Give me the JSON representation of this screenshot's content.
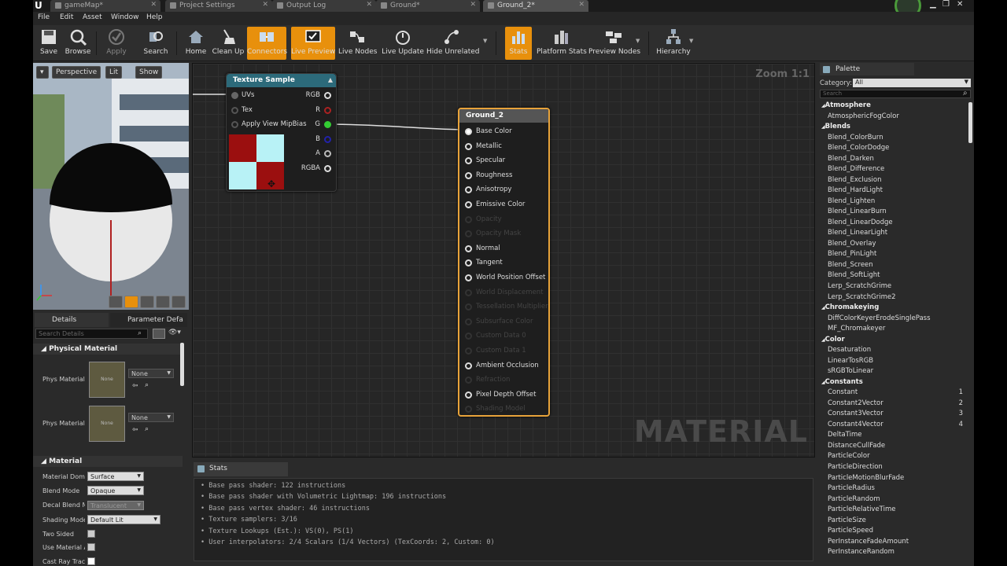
{
  "tabs": [
    {
      "label": "gameMap*",
      "active": false
    },
    {
      "label": "Project Settings",
      "active": false
    },
    {
      "label": "Output Log",
      "active": false
    },
    {
      "label": "Ground*",
      "active": false
    },
    {
      "label": "Ground_2*",
      "active": true
    }
  ],
  "menu": [
    "File",
    "Edit",
    "Asset",
    "Window",
    "Help"
  ],
  "toolbar": {
    "save": "Save",
    "browse": "Browse",
    "apply": "Apply",
    "search": "Search",
    "home": "Home",
    "clean_up": "Clean Up",
    "connectors": "Connectors",
    "live_preview": "Live Preview",
    "live_nodes": "Live Nodes",
    "live_update": "Live Update",
    "hide_unrelated": "Hide Unrelated",
    "stats": "Stats",
    "platform_stats": "Platform Stats",
    "preview_nodes": "Preview Nodes",
    "hierarchy": "Hierarchy"
  },
  "viewport": {
    "perspective": "Perspective",
    "lit": "Lit",
    "show": "Show"
  },
  "details": {
    "tab_details": "Details",
    "tab_params": "Parameter Defa",
    "search_placeholder": "Search Details",
    "cat_physical": "Physical Material",
    "phys_label_1": "Phys Material",
    "phys_label_2": "Phys Material",
    "phys_thumb_1": "None",
    "phys_thumb_2": "None",
    "phys_value_1": "None",
    "phys_value_2": "None",
    "cat_material": "Material",
    "rows": [
      {
        "label": "Material Doma",
        "value": "Surface"
      },
      {
        "label": "Blend Mode",
        "value": "Opaque"
      },
      {
        "label": "Decal Blend Mc",
        "value": "Translucent"
      },
      {
        "label": "Shading Mode",
        "value": "Default Lit"
      },
      {
        "label": "Two Sided",
        "value": ""
      },
      {
        "label": "Use Material A",
        "value": ""
      },
      {
        "label": "Cast Ray Trace",
        "value": ""
      }
    ]
  },
  "graph": {
    "zoom": "Zoom 1:1",
    "watermark": "MATERIAL",
    "texture_node": {
      "title": "Texture Sample",
      "inputs": [
        "UVs",
        "Tex",
        "Apply View MipBias"
      ],
      "outputs": [
        "RGB",
        "R",
        "G",
        "B",
        "A",
        "RGBA"
      ]
    },
    "material_node": {
      "title": "Ground_2",
      "pins": [
        {
          "label": "Base Color",
          "enabled": true
        },
        {
          "label": "Metallic",
          "enabled": true
        },
        {
          "label": "Specular",
          "enabled": true
        },
        {
          "label": "Roughness",
          "enabled": true
        },
        {
          "label": "Anisotropy",
          "enabled": true
        },
        {
          "label": "Emissive Color",
          "enabled": true
        },
        {
          "label": "Opacity",
          "enabled": false
        },
        {
          "label": "Opacity Mask",
          "enabled": false
        },
        {
          "label": "Normal",
          "enabled": true
        },
        {
          "label": "Tangent",
          "enabled": true
        },
        {
          "label": "World Position Offset",
          "enabled": true
        },
        {
          "label": "World Displacement",
          "enabled": false
        },
        {
          "label": "Tessellation Multiplier",
          "enabled": false
        },
        {
          "label": "Subsurface Color",
          "enabled": false
        },
        {
          "label": "Custom Data 0",
          "enabled": false
        },
        {
          "label": "Custom Data 1",
          "enabled": false
        },
        {
          "label": "Ambient Occlusion",
          "enabled": true
        },
        {
          "label": "Refraction",
          "enabled": false
        },
        {
          "label": "Pixel Depth Offset",
          "enabled": true
        },
        {
          "label": "Shading Model",
          "enabled": false
        }
      ]
    }
  },
  "stats": {
    "tab": "Stats",
    "lines": [
      "• Base pass shader: 122 instructions",
      "• Base pass shader with Volumetric Lightmap: 196 instructions",
      "• Base pass vertex shader: 46 instructions",
      "• Texture samplers: 3/16",
      "• Texture Lookups (Est.): VS(0), PS(1)",
      "• User interpolators: 2/4 Scalars (1/4 Vectors) (TexCoords: 2, Custom: 0)"
    ]
  },
  "palette": {
    "tab": "Palette",
    "category_label": "Category:",
    "category_value": "All",
    "search_placeholder": "Search",
    "items": [
      {
        "label": "Atmosphere",
        "head": true,
        "num": ""
      },
      {
        "label": "AtmosphericFogColor",
        "head": false,
        "num": ""
      },
      {
        "label": "Blends",
        "head": true,
        "num": ""
      },
      {
        "label": "Blend_ColorBurn",
        "head": false,
        "num": ""
      },
      {
        "label": "Blend_ColorDodge",
        "head": false,
        "num": ""
      },
      {
        "label": "Blend_Darken",
        "head": false,
        "num": ""
      },
      {
        "label": "Blend_Difference",
        "head": false,
        "num": ""
      },
      {
        "label": "Blend_Exclusion",
        "head": false,
        "num": ""
      },
      {
        "label": "Blend_HardLight",
        "head": false,
        "num": ""
      },
      {
        "label": "Blend_Lighten",
        "head": false,
        "num": ""
      },
      {
        "label": "Blend_LinearBurn",
        "head": false,
        "num": ""
      },
      {
        "label": "Blend_LinearDodge",
        "head": false,
        "num": ""
      },
      {
        "label": "Blend_LinearLight",
        "head": false,
        "num": ""
      },
      {
        "label": "Blend_Overlay",
        "head": false,
        "num": ""
      },
      {
        "label": "Blend_PinLight",
        "head": false,
        "num": ""
      },
      {
        "label": "Blend_Screen",
        "head": false,
        "num": ""
      },
      {
        "label": "Blend_SoftLight",
        "head": false,
        "num": ""
      },
      {
        "label": "Lerp_ScratchGrime",
        "head": false,
        "num": ""
      },
      {
        "label": "Lerp_ScratchGrime2",
        "head": false,
        "num": ""
      },
      {
        "label": "Chromakeying",
        "head": true,
        "num": ""
      },
      {
        "label": "DiffColorKeyerErodeSinglePass",
        "head": false,
        "num": ""
      },
      {
        "label": "MF_Chromakeyer",
        "head": false,
        "num": ""
      },
      {
        "label": "Color",
        "head": true,
        "num": ""
      },
      {
        "label": "Desaturation",
        "head": false,
        "num": ""
      },
      {
        "label": "LinearTosRGB",
        "head": false,
        "num": ""
      },
      {
        "label": "sRGBToLinear",
        "head": false,
        "num": ""
      },
      {
        "label": "Constants",
        "head": true,
        "num": ""
      },
      {
        "label": "Constant",
        "head": false,
        "num": "1"
      },
      {
        "label": "Constant2Vector",
        "head": false,
        "num": "2"
      },
      {
        "label": "Constant3Vector",
        "head": false,
        "num": "3"
      },
      {
        "label": "Constant4Vector",
        "head": false,
        "num": "4"
      },
      {
        "label": "DeltaTime",
        "head": false,
        "num": ""
      },
      {
        "label": "DistanceCullFade",
        "head": false,
        "num": ""
      },
      {
        "label": "ParticleColor",
        "head": false,
        "num": ""
      },
      {
        "label": "ParticleDirection",
        "head": false,
        "num": ""
      },
      {
        "label": "ParticleMotionBlurFade",
        "head": false,
        "num": ""
      },
      {
        "label": "ParticleRadius",
        "head": false,
        "num": ""
      },
      {
        "label": "ParticleRandom",
        "head": false,
        "num": ""
      },
      {
        "label": "ParticleRelativeTime",
        "head": false,
        "num": ""
      },
      {
        "label": "ParticleSize",
        "head": false,
        "num": ""
      },
      {
        "label": "ParticleSpeed",
        "head": false,
        "num": ""
      },
      {
        "label": "PerInstanceFadeAmount",
        "head": false,
        "num": ""
      },
      {
        "label": "PerInstanceRandom",
        "head": false,
        "num": ""
      }
    ]
  },
  "colors": {
    "accent": "#e8900c",
    "material_border": "#e8a33a",
    "texture_header": "#2c6a7a",
    "material_header": "#555555"
  }
}
